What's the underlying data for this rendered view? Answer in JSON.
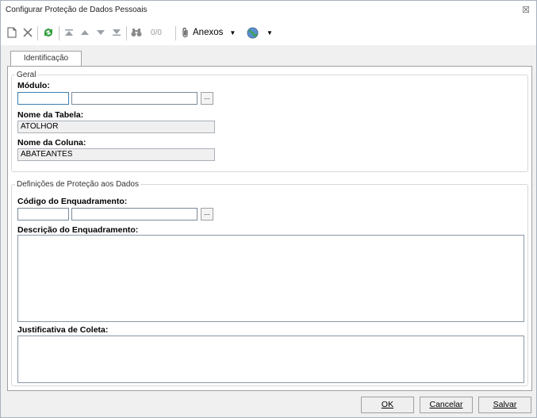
{
  "window": {
    "title": "Configurar Proteção de Dados Pessoais",
    "close_glyph": "☒"
  },
  "toolbar": {
    "counter": "0/0",
    "anexos_label": "Anexos",
    "dropdown_glyph": "▼"
  },
  "tabs": [
    {
      "label": "Identificação"
    }
  ],
  "geral": {
    "legend": "Geral",
    "modulo_label": "Módulo:",
    "modulo_code": "",
    "modulo_desc": "",
    "browse_label": "...",
    "tabela_label": "Nome da Tabela:",
    "tabela_value": "ATOLHOR",
    "coluna_label": "Nome da Coluna:",
    "coluna_value": "ABATEANTES"
  },
  "protecao": {
    "legend": "Definições de Proteção aos Dados",
    "codigo_label": "Código do Enquadramento:",
    "codigo_code": "",
    "codigo_desc": "",
    "browse_label": "...",
    "descricao_label": "Descrição do Enquadramento:",
    "justificativa_label": "Justificativa de Coleta:"
  },
  "footer": {
    "ok": "OK",
    "cancelar": "Cancelar",
    "salvar": "Salvar"
  }
}
